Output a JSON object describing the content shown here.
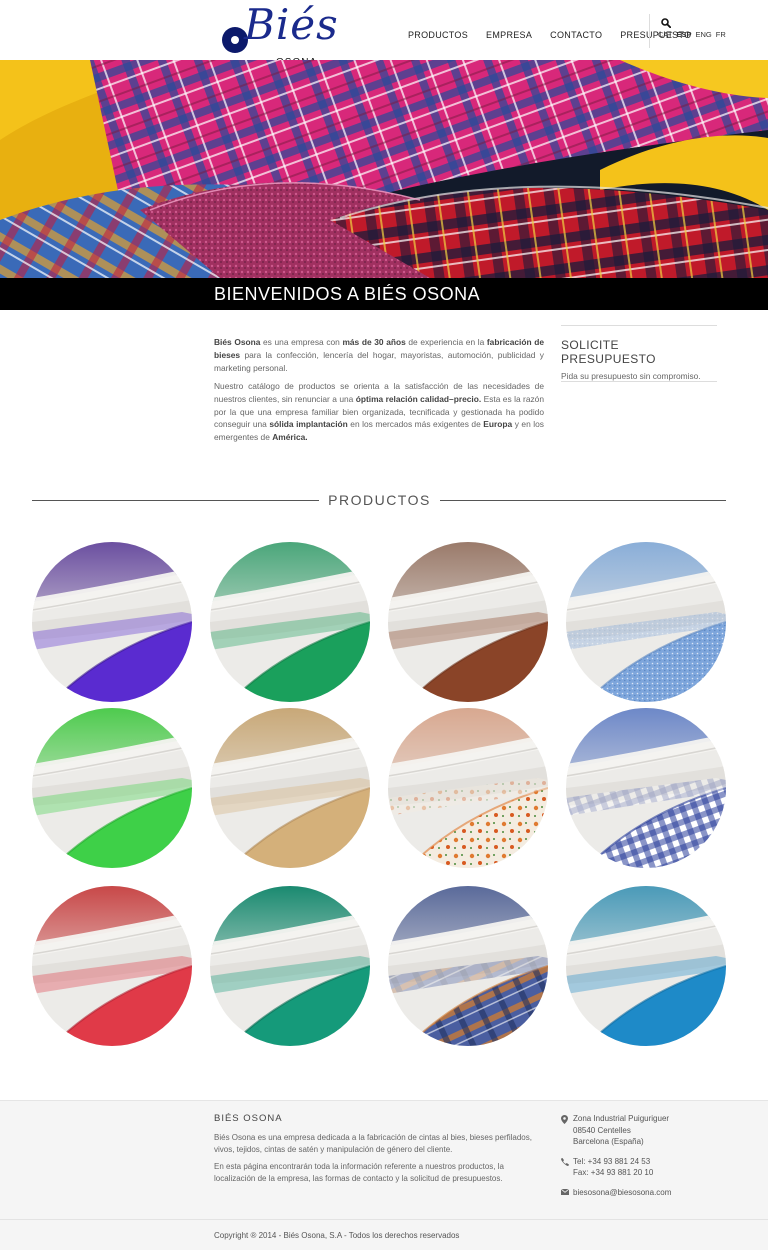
{
  "header": {
    "logo_text": "Biés",
    "logo_sub": "OSONA",
    "nav": [
      "PRODUCTOS",
      "EMPRESA",
      "CONTACTO",
      "PRESUPUESTO"
    ],
    "languages": [
      "CAT",
      "ESP",
      "ENG",
      "FR"
    ],
    "active_language": "ESP",
    "search_icon": "search-icon"
  },
  "hero": {
    "title": "BIENVENIDOS A BIÉS OSONA"
  },
  "intro": {
    "p1": [
      {
        "t": "Biés Osona",
        "b": true
      },
      {
        "t": " es una empresa con ",
        "b": false
      },
      {
        "t": "más de 30 años",
        "b": true
      },
      {
        "t": " de experiencia en la ",
        "b": false
      },
      {
        "t": "fabricación de bieses",
        "b": true
      },
      {
        "t": " para la confección, lencería del hogar, mayoristas, automoción, publicidad y marketing personal.",
        "b": false
      }
    ],
    "p2": [
      {
        "t": "Nuestro catálogo de productos se orienta a la satisfacción de las necesidades de nuestros clientes, sin renunciar a una ",
        "b": false
      },
      {
        "t": "óptima relación calidad–precio.",
        "b": true
      },
      {
        "t": " Esta es la razón por la que una empresa familiar bien organizada, tecnificada y gestionada ha podido conseguir una ",
        "b": false
      },
      {
        "t": "sólida implantación",
        "b": true
      },
      {
        "t": " en los mercados más exigentes de ",
        "b": false
      },
      {
        "t": "Europa",
        "b": true
      },
      {
        "t": " y en los emergentes de ",
        "b": false
      },
      {
        "t": "América.",
        "b": true
      }
    ]
  },
  "aside": {
    "title": "SOLICITE PRESUPUESTO",
    "text": "Pida su presupuesto sin compromiso."
  },
  "products": {
    "title": "PRODUCTOS",
    "items": [
      {
        "name": "product-purple-satin",
        "top": "#6b4fa0",
        "ribbon": "#5a2bd0",
        "ribbon_dark": "#3a1890",
        "pattern": "solid"
      },
      {
        "name": "product-green",
        "top": "#4aa67a",
        "ribbon": "#1aa05c",
        "ribbon_dark": "#0e7a42",
        "pattern": "solid"
      },
      {
        "name": "product-brown",
        "top": "#9a7a6a",
        "ribbon": "#8a4428",
        "ribbon_dark": "#6a2e18",
        "pattern": "solid"
      },
      {
        "name": "product-light-blue",
        "top": "#8aaed8",
        "ribbon": "#7ea6dc",
        "ribbon_dark": "#5a86c0",
        "pattern": "speckle"
      },
      {
        "name": "product-lime-green",
        "top": "#4ecb4e",
        "ribbon": "#3ed048",
        "ribbon_dark": "#1fa82c",
        "pattern": "solid"
      },
      {
        "name": "product-gold",
        "top": "#c8a878",
        "ribbon": "#d4b07a",
        "ribbon_dark": "#b08a58",
        "pattern": "solid"
      },
      {
        "name": "product-floral",
        "top": "#d8a890",
        "ribbon": "#f4ece0",
        "ribbon_dark": "#e07a30",
        "pattern": "floral"
      },
      {
        "name": "product-blue-gingham",
        "top": "#6d88c8",
        "ribbon": "#ffffff",
        "ribbon_dark": "#2a3e9a",
        "pattern": "gingham"
      },
      {
        "name": "product-red",
        "top": "#c84848",
        "ribbon": "#e03a48",
        "ribbon_dark": "#b02030",
        "pattern": "solid"
      },
      {
        "name": "product-teal",
        "top": "#1a8a70",
        "ribbon": "#159a7a",
        "ribbon_dark": "#0a6c54",
        "pattern": "solid"
      },
      {
        "name": "product-tartan",
        "top": "#5a6a9a",
        "ribbon": "#4a5ea0",
        "ribbon_dark": "#d07a30",
        "pattern": "tartan"
      },
      {
        "name": "product-turquoise",
        "top": "#4a9ab8",
        "ribbon": "#1e8ac8",
        "ribbon_dark": "#0e6aa0",
        "pattern": "solid"
      }
    ]
  },
  "footer": {
    "brand": "BIÉS OSONA",
    "desc1": "Biés Osona es una empresa dedicada a la fabricación de cintas al bies, bieses perfilados, vivos, tejidos, cintas de satén y manipulación de género del cliente.",
    "desc2": "En esta página encontrarán toda la información referente a nuestros productos, la localización de la empresa, las formas de contacto y la solicitud de presupuestos.",
    "address": [
      "Zona Industrial Puiguriguer",
      "08540 Centelles",
      "Barcelona (España)"
    ],
    "tel": "Tel: +34 93 881 24 53",
    "fax": "Fax: +34 93 881 20 10",
    "email": "biesosona@biesosona.com",
    "copyright": "Copyright ® 2014 - Biés Osona, S.A - Todos los derechos reservados"
  }
}
